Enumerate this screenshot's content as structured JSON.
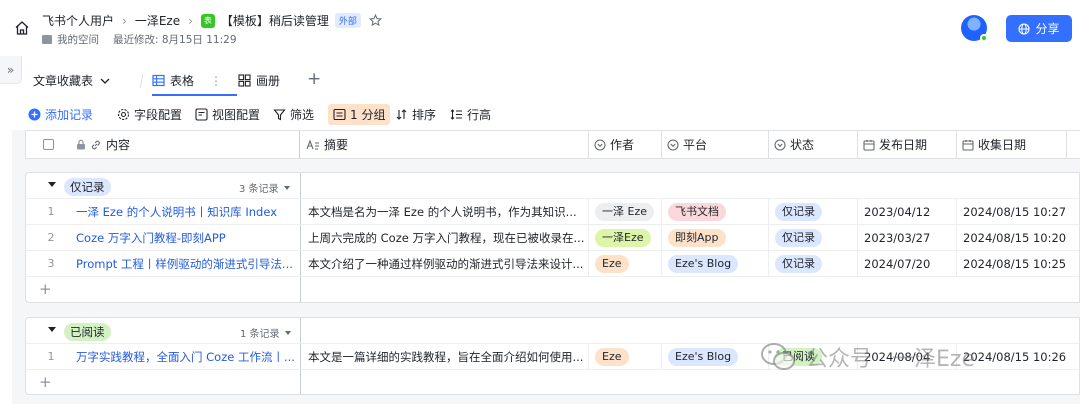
{
  "breadcrumb": {
    "root": "飞书个人用户",
    "parent": "一泽Eze",
    "doc_icon": "表",
    "doc_title": "【模板】稍后读管理",
    "doc_tag": "外部"
  },
  "subline": {
    "space": "我的空间",
    "last_modified": "最近修改: 8月15日 11:29"
  },
  "share_label": "分享",
  "tabs": {
    "table_name": "文章收藏表",
    "view_grid": "表格",
    "view_gallery": "画册",
    "add": "+"
  },
  "toolbar": {
    "add_record": "添加记录",
    "field_config": "字段配置",
    "view_config": "视图配置",
    "filter": "筛选",
    "group": "1 分组",
    "sort": "排序",
    "row_height": "行高"
  },
  "columns": {
    "content": "内容",
    "summary": "摘要",
    "author": "作者",
    "platform": "平台",
    "status": "状态",
    "publish_date": "发布日期",
    "collect_date": "收集日期"
  },
  "groups": [
    {
      "name": "仅记录",
      "count": "3 条记录",
      "rows": [
        {
          "index": "1",
          "content": "一泽 Eze 的个人说明书丨知识库 Index",
          "summary": "本文档是名为一泽 Eze 的个人说明书，作为其知识...",
          "author": "一泽 Eze",
          "platform": "飞书文档",
          "status": "仅记录",
          "publish_date": "2023/04/12",
          "collect_date": "2024/08/15 10:27"
        },
        {
          "index": "2",
          "content": "Coze 万字入门教程-即刻APP",
          "summary": "上周六完成的 Coze 万字入门教程，现在已被收录在...",
          "author": "一泽Eze",
          "platform": "即刻App",
          "status": "仅记录",
          "publish_date": "2023/03/27",
          "collect_date": "2024/08/15 10:20"
        },
        {
          "index": "3",
          "content": "Prompt 工程丨样例驱动的渐进式引导法...",
          "summary": "本文介绍了一种通过样例驱动的渐进式引导法来设计...",
          "author": "Eze",
          "platform": "Eze's Blog",
          "status": "仅记录",
          "publish_date": "2024/07/20",
          "collect_date": "2024/08/15 10:25"
        }
      ]
    },
    {
      "name": "已阅读",
      "count": "1 条记录",
      "rows": [
        {
          "index": "1",
          "content": "万字实践教程，全面入门 Coze 工作流丨...",
          "summary": "本文是一篇详细的实践教程，旨在全面介绍如何使用...",
          "author": "Eze",
          "platform": "Eze's Blog",
          "status": "已阅读",
          "publish_date": "2024/08/04",
          "collect_date": "2024/08/15 10:26"
        }
      ]
    }
  ],
  "watermark": {
    "account": "公众号",
    "author": "一泽Eze"
  },
  "colors": {
    "accent": "#3370ff",
    "group_tag_record": "#dbe6ff",
    "group_tag_read": "#d3f2c4",
    "author_gray": "#eceef0",
    "author_lime": "#ddf5a8",
    "author_orange": "#fde2c9",
    "platform_pink": "#fcd8dc",
    "platform_orange": "#fde2c9",
    "platform_blue": "#dbe6ff",
    "status_blue": "#dbe6ff",
    "status_green": "#d3f2c4"
  },
  "icons": {
    "home": "home-icon",
    "star": "star-icon",
    "globe": "globe-icon",
    "collapse": "double-chevron-right-icon"
  }
}
